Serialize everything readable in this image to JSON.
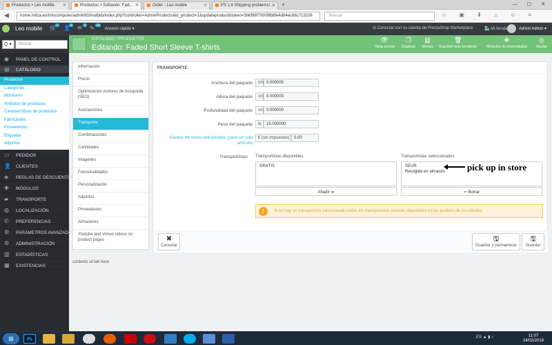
{
  "browser": {
    "tabs": [
      {
        "label": "Productos • Leo mobile"
      },
      {
        "label": "Productos > Editando: Fad..."
      },
      {
        "label": "Order - Leo mobile"
      },
      {
        "label": "PS 1.6 Shipping problems! ..."
      }
    ],
    "new_tab": "+",
    "url": "home.mitza.es/infocomputer/admin810nu8jkb/index.php?controller=AdminProducts&id_product=1&updateproduct&token=3b6f98f70009fb8fe4d64ec88c713226",
    "search_placeholder": "Buscar"
  },
  "admin_header": {
    "shop_name": "Leo mobile",
    "badges": [
      "1",
      "1",
      "2",
      "13"
    ],
    "quick_access": "Acceso rápido",
    "connect": "Conectar con su cuenta de PrestaShop Marketplace",
    "my_shop": "Mi tienda",
    "admin_name": "Admin Admin"
  },
  "sidebar": {
    "search_placeholder": "Buscar",
    "search_select": "Q",
    "menu_top": [
      {
        "label": "PANEL DE CONTROL",
        "icon": "dashboard-icon"
      },
      {
        "label": "CATÁLOGO",
        "icon": "book-icon"
      }
    ],
    "catalog_sub": [
      "Productos",
      "Categorías",
      "Monitoreo",
      "Atributos de productos",
      "Características de productos",
      "Fabricantes",
      "Proveedores",
      "Etiquetas",
      "Adjuntos"
    ],
    "menu_bottom": [
      {
        "label": "PEDIDOS",
        "icon": "credit-card-icon"
      },
      {
        "label": "CLIENTES",
        "icon": "user-icon"
      },
      {
        "label": "REGLAS DE DESCUENTOS",
        "icon": "tag-icon"
      },
      {
        "label": "MÓDULOS",
        "icon": "puzzle-icon"
      },
      {
        "label": "TRANSPORTE",
        "icon": "truck-icon"
      },
      {
        "label": "LOCALIZACIÓN",
        "icon": "globe-icon"
      },
      {
        "label": "PREFERENCIAS",
        "icon": "wrench-icon"
      },
      {
        "label": "PARÁMETROS AVANZADOS",
        "icon": "cogs-icon"
      },
      {
        "label": "ADMINISTRACIÓN",
        "icon": "cog-icon"
      },
      {
        "label": "ESTADÍSTICAS",
        "icon": "bar-chart-icon"
      },
      {
        "label": "EXISTENCIAS",
        "icon": "archive-icon"
      }
    ]
  },
  "toolbar": {
    "breadcrumb_1": "CATÁLOGO",
    "breadcrumb_sep": "/",
    "breadcrumb_2": "PRODUCTOS",
    "title": "Editando: Faded Short Sleeve T-shirts",
    "buttons": [
      {
        "label": "Vista previa",
        "icon": "eye-icon"
      },
      {
        "label": "Duplicar",
        "icon": "copy-icon"
      },
      {
        "label": "Ventas",
        "icon": "bar-chart-icon"
      },
      {
        "label": "Suprimir este producto",
        "icon": "trash-icon"
      },
      {
        "label": "Módulos recomendados",
        "icon": "puzzle-icon"
      },
      {
        "label": "Ayuda",
        "icon": "help-icon"
      }
    ]
  },
  "product_tabs": [
    "Información",
    "Precio",
    "Optimización motores de búsqueda (SEO)",
    "Asociaciones",
    "Transporte",
    "Combinaciones",
    "Cantidades",
    "Imágenes",
    "Funcionalidades",
    "Personalización",
    "Adjuntos",
    "Proveedores",
    "Almacenes",
    "Youtube and Vimeo videos on product pages"
  ],
  "tab_footer": "contents of tab here",
  "panel": {
    "heading": "TRANSPORTE",
    "fields": [
      {
        "label": "Anchura del paquete",
        "unit": "cm",
        "value": "0.000000"
      },
      {
        "label": "Altura del paquete",
        "unit": "cm",
        "value": "0.000000"
      },
      {
        "label": "Profundidad del paquete",
        "unit": "cm",
        "value": "0.000000"
      },
      {
        "label": "Peso del paquete",
        "unit": "lb",
        "value": "15.000000"
      }
    ],
    "shipping_cost": {
      "label": "Gastos de envío adicionales (para un sólo artículo)",
      "unit": "€ (sin impuestos)",
      "value": "0.00"
    },
    "carriers_label": "Transportistas",
    "available_title": "Transportistas disponibles",
    "available": [
      "GRATIS"
    ],
    "selected_title": "Transportistas seleccionados",
    "selected": [
      "SEUR",
      "Recogida en almacén"
    ],
    "add_button": "Añadir ➔",
    "remove_button": "⇦ Borrar",
    "warning": "Si no hay un transportista seleccionado todos los transportistas estarán disponibles en los pedidos de los clientes.",
    "cancel": "Cancelar",
    "save_stay": "Guardar y permanecer",
    "save": "Guardar"
  },
  "annotation": "pick up in store",
  "taskbar": {
    "apps": [
      "Ps",
      "",
      "",
      "",
      "",
      "",
      "",
      "",
      "",
      "",
      "",
      "",
      ""
    ],
    "lang": "ES",
    "time": "11:07",
    "date": "24/02/2018"
  }
}
